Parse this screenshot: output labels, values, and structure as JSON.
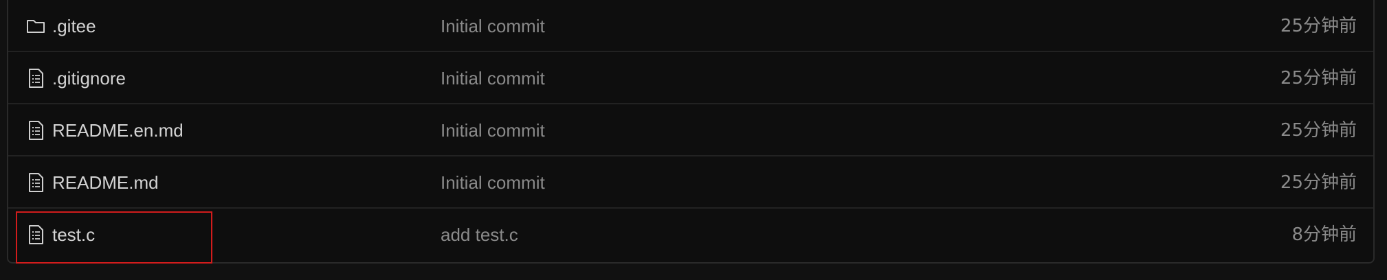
{
  "files": [
    {
      "name": ".gitee",
      "type": "folder",
      "icon": "folder-icon",
      "message": "Initial commit",
      "time": "25分钟前"
    },
    {
      "name": ".gitignore",
      "type": "file",
      "icon": "file-text-icon",
      "message": "Initial commit",
      "time": "25分钟前"
    },
    {
      "name": "README.en.md",
      "type": "file",
      "icon": "file-text-icon",
      "message": "Initial commit",
      "time": "25分钟前"
    },
    {
      "name": "README.md",
      "type": "file",
      "icon": "file-text-icon",
      "message": "Initial commit",
      "time": "25分钟前"
    },
    {
      "name": "test.c",
      "type": "file",
      "icon": "file-text-icon",
      "message": "add test.c",
      "time": "8分钟前"
    }
  ],
  "colors": {
    "background": "#111111",
    "row_border": "#222222",
    "name_text": "#d4d4d4",
    "secondary_text": "#8a8a8a",
    "highlight": "#d21c1c"
  }
}
